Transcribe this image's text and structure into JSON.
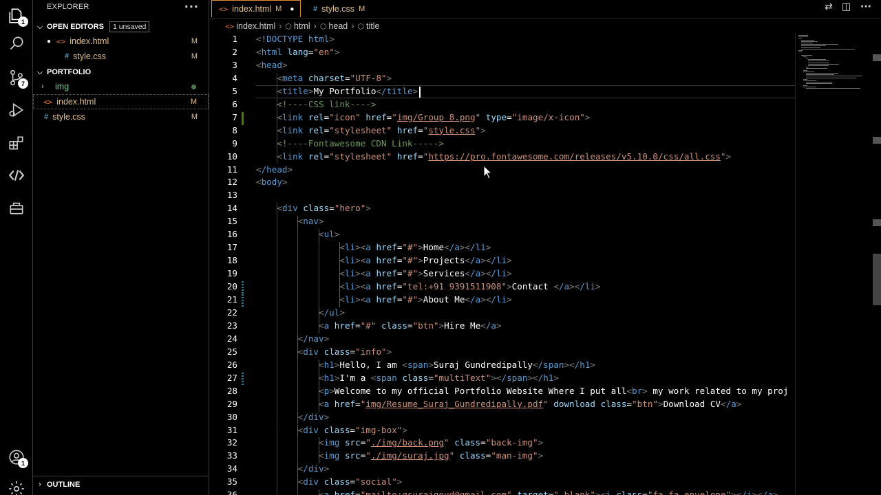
{
  "activity_bar": {
    "explorer_badge": "1",
    "scm_badge": "7",
    "account_badge": "1"
  },
  "sidebar": {
    "title": "EXPLORER",
    "more": "···",
    "open_editors": {
      "label": "OPEN EDITORS",
      "badge": "1 unsaved",
      "items": [
        {
          "name": "index.html",
          "status": "M",
          "dirty": true
        },
        {
          "name": "style.css",
          "status": "M",
          "dirty": false
        }
      ]
    },
    "portfolio": {
      "label": "PORTFOLIO",
      "items": [
        {
          "name": "img",
          "status": "",
          "type": "folder"
        },
        {
          "name": "index.html",
          "status": "M",
          "type": "html"
        },
        {
          "name": "style.css",
          "status": "M",
          "type": "css"
        }
      ]
    },
    "outline": {
      "label": "OUTLINE"
    }
  },
  "tabs": [
    {
      "label": "index.html",
      "status": "M",
      "active": true,
      "dirty": true
    },
    {
      "label": "style.css",
      "status": "M",
      "active": false,
      "dirty": false
    }
  ],
  "breadcrumbs": [
    "index.html",
    "html",
    "head",
    "title"
  ],
  "editor": {
    "line_numbers": [
      "1",
      "2",
      "3",
      "4",
      "5",
      "6",
      "7",
      "8",
      "9",
      "10",
      "11",
      "12",
      "13",
      "14",
      "15",
      "16",
      "17",
      "18",
      "19",
      "20",
      "21",
      "22",
      "23",
      "24",
      "25",
      "26",
      "27",
      "28",
      "29",
      "30",
      "31",
      "32",
      "33",
      "34",
      "35",
      "36"
    ],
    "lines": [
      "<!DOCTYPE html>",
      "<html lang=\"en\">",
      "<head>",
      "    <meta charset=\"UTF-8\">",
      "    <title>My Portfolio</title>",
      "    <!----CSS link---->",
      "    <link rel=\"icon\" href=\"img/Group 8.png\" type=\"image/x-icon\">",
      "    <link rel=\"stylesheet\" href=\"style.css\">",
      "    <!----Fontawesome CDN Link----->",
      "    <link rel=\"stylesheet\" href=\"https://pro.fontawesome.com/releases/v5.10.0/css/all.css\">",
      "</head>",
      "<body>",
      "",
      "    <div class=\"hero\">",
      "        <nav>",
      "            <ul>",
      "                <li><a href=\"#\">Home</a></li>",
      "                <li><a href=\"#\">Projects</a></li>",
      "                <li><a href=\"#\">Services</a></li>",
      "                <li><a href=\"tel:+91 9391511908\">Contact </a></li>",
      "                <li><a href=\"#\">About Me</a></li>",
      "            </ul>",
      "            <a href=\"#\" class=\"btn\">Hire Me</a>",
      "        </nav>",
      "        <div class=\"info\">",
      "            <h1>Hello, I am <span>Suraj Gundredipally</span></h1>",
      "            <h1>I'm a <span class=\"multiText\"></span></h1>",
      "            <p>Welcome to my official Portfolio Website Where I put all<br> my work related to my proj",
      "            <a href=\"img/Resume_Suraj_Gundredipally.pdf\" download class=\"btn\">Download CV</a>",
      "        </div>",
      "        <div class=\"img-box\">",
      "            <img src=\"./img/back.png\" class=\"back-img\">",
      "            <img src=\"./img/suraj.jpg\" class=\"man-img\">",
      "        </div>",
      "        <div class=\"social\">",
      "            <a href=\"mailto:gsurajgoud@gmail.com\" target=\"_blank\"><i class=\"fa fa-envelope\"></i></a>"
    ]
  },
  "colors": {
    "background": "#000000",
    "tab_active_border": "#e38c3a",
    "html_icon": "#e37933",
    "css_icon": "#519aba",
    "modified_text": "#e2c08d",
    "tag": "#569cd6",
    "attribute": "#9cdcfe",
    "string": "#ce9178",
    "comment": "#6a9955"
  }
}
